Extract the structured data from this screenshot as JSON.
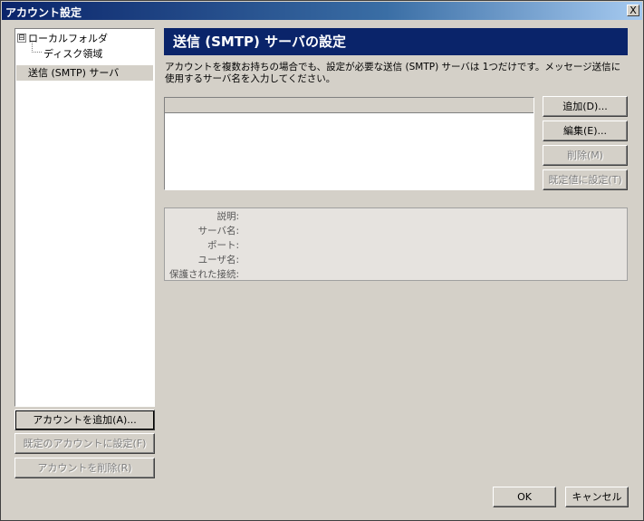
{
  "window": {
    "title": "アカウント設定",
    "close_label": "X"
  },
  "tree": {
    "items": [
      {
        "label": "ローカルフォルダ",
        "expander": "⊟"
      },
      {
        "label": "ディスク領域"
      },
      {
        "label": "送信 (SMTP) サーバ"
      }
    ]
  },
  "left_buttons": {
    "add_account": "アカウントを追加(A)...",
    "set_default": "既定のアカウントに設定(F)",
    "remove_account": "アカウントを削除(R)"
  },
  "panel": {
    "title": "送信 (SMTP) サーバの設定",
    "description": "アカウントを複数お持ちの場合でも、設定が必要な送信 (SMTP) サーバは 1つだけです。メッセージ送信に使用するサーバ名を入力してください。"
  },
  "server_buttons": {
    "add": "追加(D)...",
    "edit": "編集(E)...",
    "delete": "削除(M)",
    "set_default": "既定値に設定(T)"
  },
  "details": {
    "description_label": "説明:",
    "server_label": "サーバ名:",
    "port_label": "ポート:",
    "user_label": "ユーザ名:",
    "secure_label": "保護された接続:"
  },
  "footer": {
    "ok": "OK",
    "cancel": "キャンセル"
  }
}
